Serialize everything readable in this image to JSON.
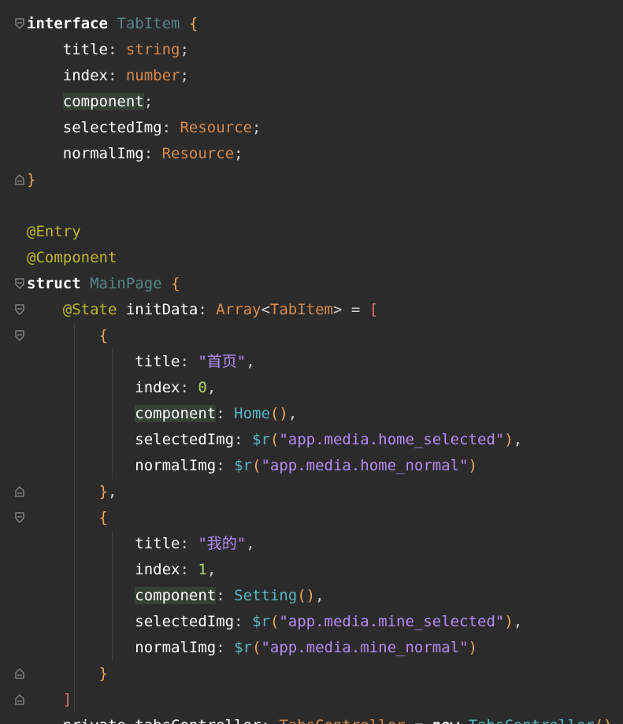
{
  "editor": {
    "lines": [
      [
        {
          "t": "interface",
          "c": "kw"
        },
        {
          "t": " "
        },
        {
          "t": "TabItem",
          "c": "type"
        },
        {
          "t": " "
        },
        {
          "t": "{",
          "c": "brace"
        }
      ],
      [
        {
          "t": "    title",
          "c": "plain"
        },
        {
          "t": ": ",
          "c": "punc"
        },
        {
          "t": "string",
          "c": "ref"
        },
        {
          "t": ";",
          "c": "punc"
        }
      ],
      [
        {
          "t": "    index",
          "c": "plain"
        },
        {
          "t": ": ",
          "c": "punc"
        },
        {
          "t": "number",
          "c": "ref"
        },
        {
          "t": ";",
          "c": "punc"
        }
      ],
      [
        {
          "t": "    "
        },
        {
          "t": "component",
          "c": "plain",
          "hl": true
        },
        {
          "t": ";",
          "c": "punc"
        }
      ],
      [
        {
          "t": "    selectedImg",
          "c": "plain"
        },
        {
          "t": ": ",
          "c": "punc"
        },
        {
          "t": "Resource",
          "c": "ref"
        },
        {
          "t": ";",
          "c": "punc"
        }
      ],
      [
        {
          "t": "    normalImg",
          "c": "plain"
        },
        {
          "t": ": ",
          "c": "punc"
        },
        {
          "t": "Resource",
          "c": "ref"
        },
        {
          "t": ";",
          "c": "punc"
        }
      ],
      [
        {
          "t": "}",
          "c": "brace"
        }
      ],
      [],
      [
        {
          "t": "@Entry",
          "c": "ann"
        }
      ],
      [
        {
          "t": "@Component",
          "c": "ann"
        }
      ],
      [
        {
          "t": "struct",
          "c": "kw"
        },
        {
          "t": " "
        },
        {
          "t": "MainPage",
          "c": "type"
        },
        {
          "t": " "
        },
        {
          "t": "{",
          "c": "brace"
        }
      ],
      [
        {
          "t": "    "
        },
        {
          "t": "@State",
          "c": "ann"
        },
        {
          "t": " initData",
          "c": "plain"
        },
        {
          "t": ": ",
          "c": "punc"
        },
        {
          "t": "Array",
          "c": "ref"
        },
        {
          "t": "<",
          "c": "punc"
        },
        {
          "t": "TabItem",
          "c": "ref"
        },
        {
          "t": "> = ",
          "c": "punc"
        },
        {
          "t": "[",
          "c": "ref2"
        }
      ],
      [
        {
          "t": "        "
        },
        {
          "t": "{",
          "c": "brace"
        }
      ],
      [
        {
          "t": "            title",
          "c": "plain"
        },
        {
          "t": ": ",
          "c": "punc"
        },
        {
          "t": "\"首页\"",
          "c": "str"
        },
        {
          "t": ",",
          "c": "punc"
        }
      ],
      [
        {
          "t": "            index",
          "c": "plain"
        },
        {
          "t": ": ",
          "c": "punc"
        },
        {
          "t": "0",
          "c": "num"
        },
        {
          "t": ",",
          "c": "punc"
        }
      ],
      [
        {
          "t": "            "
        },
        {
          "t": "component",
          "c": "plain",
          "hl": true
        },
        {
          "t": ": ",
          "c": "punc"
        },
        {
          "t": "Home",
          "c": "func"
        },
        {
          "t": "()",
          "c": "brace"
        },
        {
          "t": ",",
          "c": "punc"
        }
      ],
      [
        {
          "t": "            selectedImg",
          "c": "plain"
        },
        {
          "t": ": ",
          "c": "punc"
        },
        {
          "t": "$r",
          "c": "func"
        },
        {
          "t": "(",
          "c": "brace"
        },
        {
          "t": "\"app.media.home_selected\"",
          "c": "str"
        },
        {
          "t": ")",
          "c": "brace"
        },
        {
          "t": ",",
          "c": "punc"
        }
      ],
      [
        {
          "t": "            normalImg",
          "c": "plain"
        },
        {
          "t": ": ",
          "c": "punc"
        },
        {
          "t": "$r",
          "c": "func"
        },
        {
          "t": "(",
          "c": "brace"
        },
        {
          "t": "\"app.media.home_normal\"",
          "c": "str"
        },
        {
          "t": ")",
          "c": "brace"
        }
      ],
      [
        {
          "t": "        "
        },
        {
          "t": "}",
          "c": "brace"
        },
        {
          "t": ",",
          "c": "punc"
        }
      ],
      [
        {
          "t": "        "
        },
        {
          "t": "{",
          "c": "brace"
        }
      ],
      [
        {
          "t": "            title",
          "c": "plain"
        },
        {
          "t": ": ",
          "c": "punc"
        },
        {
          "t": "\"我的\"",
          "c": "str"
        },
        {
          "t": ",",
          "c": "punc"
        }
      ],
      [
        {
          "t": "            index",
          "c": "plain"
        },
        {
          "t": ": ",
          "c": "punc"
        },
        {
          "t": "1",
          "c": "num"
        },
        {
          "t": ",",
          "c": "punc"
        }
      ],
      [
        {
          "t": "            "
        },
        {
          "t": "component",
          "c": "plain",
          "hl": true
        },
        {
          "t": ": ",
          "c": "punc"
        },
        {
          "t": "Setting",
          "c": "func"
        },
        {
          "t": "()",
          "c": "brace"
        },
        {
          "t": ",",
          "c": "punc"
        }
      ],
      [
        {
          "t": "            selectedImg",
          "c": "plain"
        },
        {
          "t": ": ",
          "c": "punc"
        },
        {
          "t": "$r",
          "c": "func"
        },
        {
          "t": "(",
          "c": "brace"
        },
        {
          "t": "\"app.media.mine_selected\"",
          "c": "str"
        },
        {
          "t": ")",
          "c": "brace"
        },
        {
          "t": ",",
          "c": "punc"
        }
      ],
      [
        {
          "t": "            normalImg",
          "c": "plain"
        },
        {
          "t": ": ",
          "c": "punc"
        },
        {
          "t": "$r",
          "c": "func"
        },
        {
          "t": "(",
          "c": "brace"
        },
        {
          "t": "\"app.media.mine_normal\"",
          "c": "str"
        },
        {
          "t": ")",
          "c": "brace"
        }
      ],
      [
        {
          "t": "        "
        },
        {
          "t": "}",
          "c": "brace"
        }
      ],
      [
        {
          "t": "    "
        },
        {
          "t": "]",
          "c": "ref2"
        }
      ],
      [
        {
          "t": "    private tabsController",
          "c": "plain"
        },
        {
          "t": ": ",
          "c": "punc"
        },
        {
          "t": "TabsController",
          "c": "ref"
        },
        {
          "t": " = ",
          "c": "punc"
        },
        {
          "t": "new",
          "c": "kw"
        },
        {
          "t": " "
        },
        {
          "t": "TabsController",
          "c": "func"
        },
        {
          "t": "()",
          "c": "brace"
        }
      ]
    ],
    "fold_icons": [
      {
        "line": 0,
        "kind": "fold-open-icon"
      },
      {
        "line": 6,
        "kind": "fold-close-icon"
      },
      {
        "line": 10,
        "kind": "fold-open-icon"
      },
      {
        "line": 11,
        "kind": "fold-open-icon"
      },
      {
        "line": 12,
        "kind": "fold-open-icon"
      },
      {
        "line": 18,
        "kind": "fold-close-icon"
      },
      {
        "line": 19,
        "kind": "fold-open-icon"
      },
      {
        "line": 25,
        "kind": "fold-close-icon"
      },
      {
        "line": 26,
        "kind": "fold-close-icon"
      }
    ],
    "colors": {
      "background": "#2b2b2b",
      "keyword": "#ffffff",
      "type": "#568585",
      "brace": "#f0a65a",
      "reference": "#d98a4a",
      "annotation": "#bbb529",
      "number": "#b3d46a",
      "string": "#b38cf5",
      "function": "#56b6c2",
      "highlight": "#344134"
    }
  }
}
